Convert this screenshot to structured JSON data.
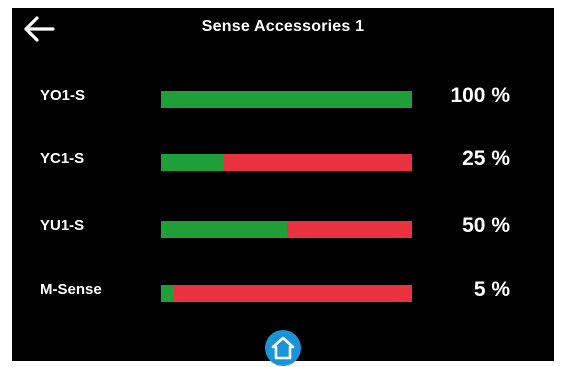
{
  "header": {
    "title": "Sense Accessories 1",
    "back_icon": "arrow-left-icon"
  },
  "rows": [
    {
      "label": "YO1-S",
      "percent_text": "100 %",
      "level": 1.0
    },
    {
      "label": "YC1-S",
      "percent_text": "25 %",
      "level": 0.25
    },
    {
      "label": "YU1-S",
      "percent_text": "50 %",
      "level": 0.5
    },
    {
      "label": "M-Sense",
      "percent_text": "5 %",
      "level": 0.05
    }
  ],
  "footer": {
    "home_icon": "home-icon"
  },
  "colors": {
    "background": "#000000",
    "bar_fill": "#1f9e3a",
    "bar_remaining": "#e8323f",
    "home_button": "#1a93d8",
    "text": "#ffffff"
  }
}
